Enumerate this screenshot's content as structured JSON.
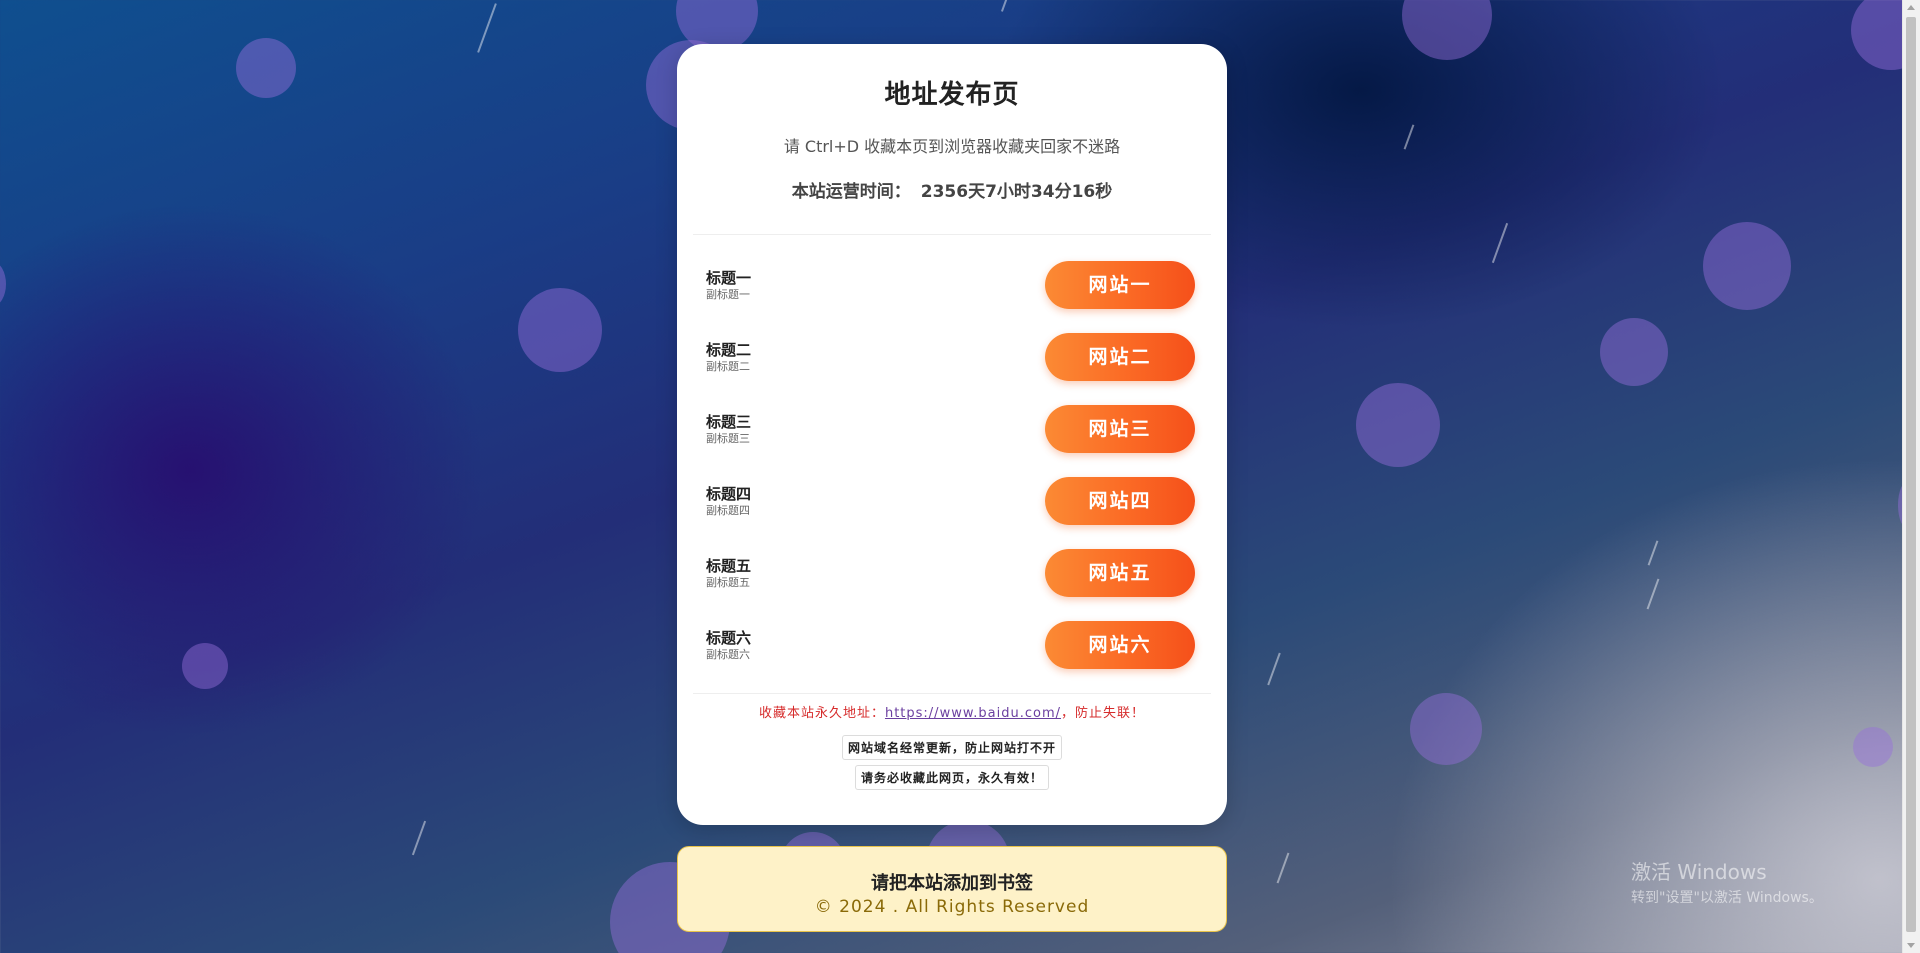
{
  "page": {
    "title": "地址发布页",
    "subtitle": "请 Ctrl+D 收藏本页到浏览器收藏夹回家不迷路",
    "runtime_label": "本站运营时间：",
    "runtime_value": "2356天7小时34分16秒"
  },
  "sites": [
    {
      "title": "标题一",
      "subtitle": "副标题一",
      "button": "网站一"
    },
    {
      "title": "标题二",
      "subtitle": "副标题二",
      "button": "网站二"
    },
    {
      "title": "标题三",
      "subtitle": "副标题三",
      "button": "网站三"
    },
    {
      "title": "标题四",
      "subtitle": "副标题四",
      "button": "网站四"
    },
    {
      "title": "标题五",
      "subtitle": "副标题五",
      "button": "网站五"
    },
    {
      "title": "标题六",
      "subtitle": "副标题六",
      "button": "网站六"
    }
  ],
  "permanent": {
    "prefix": "收藏本站永久地址：",
    "url": "https://www.baidu.com/",
    "suffix": "，防止失联！"
  },
  "notes": {
    "line1": "网站域名经常更新，防止网站打不开",
    "line2": "请务必收藏此网页，永久有效！"
  },
  "footer": {
    "title": "请把本站添加到书签",
    "copyright": "© 2024 . All Rights Reserved"
  },
  "watermark": {
    "line1": "激活 Windows",
    "line2": "转到\"设置\"以激活 Windows。"
  },
  "colors": {
    "button_start": "#fb8a34",
    "button_end": "#f5501a",
    "permanent_text": "#d62b2b",
    "footer_bg": "#fef2c8"
  }
}
